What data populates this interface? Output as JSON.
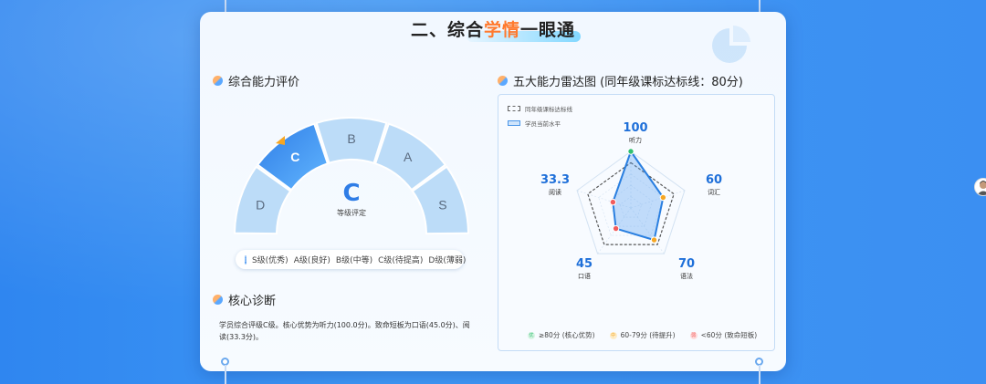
{
  "title": {
    "part1": "二、综合",
    "highlight": "学情",
    "part2": "一眼通"
  },
  "left": {
    "section_title": "综合能力评价",
    "gauge": {
      "segments": [
        "D",
        "C",
        "B",
        "A",
        "S"
      ],
      "active": "C",
      "grade": "C",
      "grade_label": "等级评定"
    },
    "legend": {
      "info_icon": "i",
      "items": [
        "S级(优秀)",
        "A级(良好)",
        "B级(中等)",
        "C级(待提高)",
        "D级(薄弱)"
      ]
    },
    "diagnosis_title": "核心诊断",
    "diagnosis_text": "学员综合评级C级。核心优势为听力(100.0分)。致命短板为口语(45.0分)、阅读(33.3分)。"
  },
  "right": {
    "section_title": "五大能力雷达图 (同年级课标达标线：80分)",
    "legend_baseline": "同年级课标达标线",
    "legend_current": "学员当前水平",
    "scores": [
      {
        "name": "听力",
        "value": "100"
      },
      {
        "name": "词汇",
        "value": "60"
      },
      {
        "name": "语法",
        "value": "70"
      },
      {
        "name": "口语",
        "value": "45"
      },
      {
        "name": "阅读",
        "value": "33.3"
      }
    ],
    "bottom_legend": [
      {
        "label": "≥80分 (核心优势)",
        "color": "#2fbf71",
        "glyph": "优"
      },
      {
        "label": "60-79分 (待提升)",
        "color": "#f5a623",
        "glyph": "中"
      },
      {
        "label": "<60分 (致命短板)",
        "color": "#f25b5b",
        "glyph": "弱"
      }
    ]
  },
  "colors": {
    "accent": "#3d8ff0",
    "highlight": "#ff7a2e"
  }
}
